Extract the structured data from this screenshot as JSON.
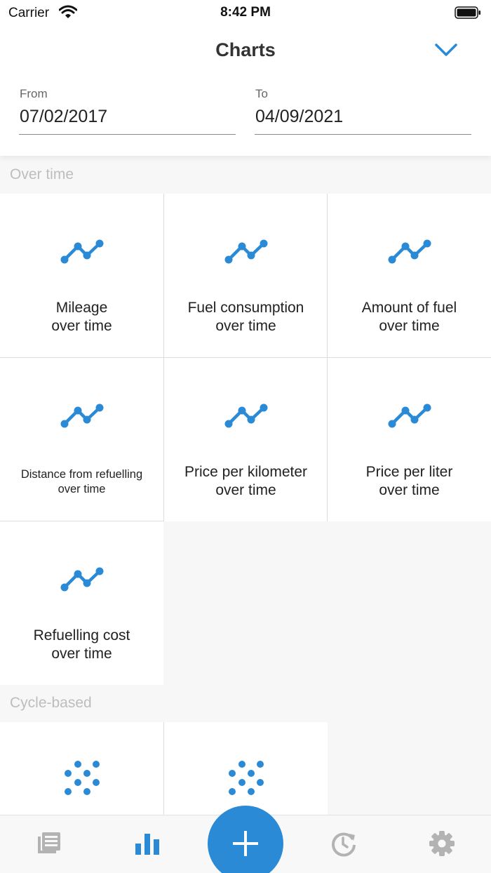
{
  "status_bar": {
    "carrier": "Carrier",
    "time": "8:42 PM"
  },
  "header": {
    "title": "Charts",
    "from_label": "From",
    "from_value": "07/02/2017",
    "to_label": "To",
    "to_value": "04/09/2021"
  },
  "sections": {
    "over_time": "Over time",
    "cycle_based": "Cycle-based"
  },
  "tiles": [
    {
      "line1": "Mileage",
      "line2": "over time",
      "icon": "line-chart-icon"
    },
    {
      "line1": "Fuel consumption",
      "line2": "over time",
      "icon": "line-chart-icon"
    },
    {
      "line1": "Amount of fuel",
      "line2": "over time",
      "icon": "line-chart-icon"
    },
    {
      "line1": "Distance from refuelling",
      "line2": "over time",
      "icon": "line-chart-icon"
    },
    {
      "line1": "Price per kilometer",
      "line2": "over time",
      "icon": "line-chart-icon"
    },
    {
      "line1": "Price per liter",
      "line2": "over time",
      "icon": "line-chart-icon"
    },
    {
      "line1": "Refuelling cost",
      "line2": "over time",
      "icon": "line-chart-icon"
    }
  ],
  "cycle_tiles": [
    {
      "icon": "scatter-chart-icon"
    },
    {
      "icon": "scatter-chart-icon"
    }
  ],
  "tabbar": {
    "icons": [
      "list-icon",
      "bar-chart-icon",
      "add-icon",
      "history-icon",
      "gear-icon"
    ],
    "active": "bar-chart-icon"
  },
  "colors": {
    "accent": "#2a8ad6",
    "inactive": "#b3b3b3"
  }
}
